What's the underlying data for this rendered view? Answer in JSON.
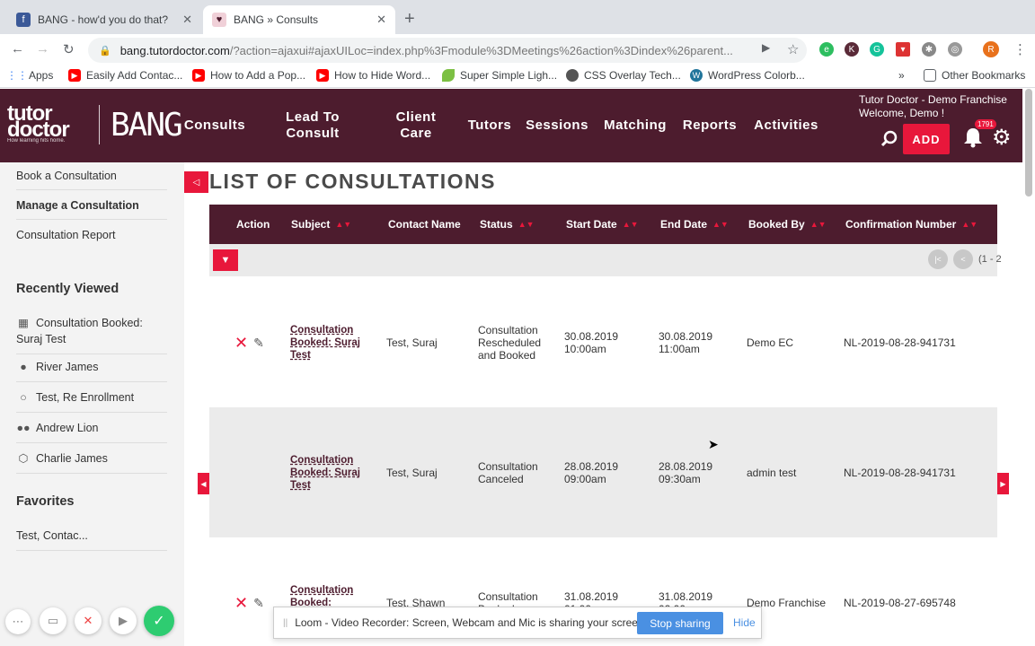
{
  "browser": {
    "tabs": [
      {
        "title": "BANG - how'd you do that?",
        "icon": "facebook-icon"
      },
      {
        "title": "BANG » Consults",
        "icon": "bang-favicon"
      }
    ],
    "url_host": "bang.tutordoctor.com",
    "url_rest": "/?action=ajaxui#ajaxUILoc=index.php%3Fmodule%3DMeetings%26action%3Dindex%26parent...",
    "bookmarks": [
      "Apps",
      "Easily Add Contac...",
      "How to Add a Pop...",
      "How to Hide Word...",
      "Super Simple Ligh...",
      "CSS Overlay Tech...",
      "WordPress Colorb..."
    ],
    "other_bookmarks": "Other Bookmarks",
    "profile_initial": "R"
  },
  "header": {
    "logo_text": "tutor doctor",
    "logo_sub": "How learning hits home.",
    "app_name": "BANG",
    "nav": [
      "Consults",
      "Lead To Consult",
      "Client Care",
      "Tutors",
      "Sessions",
      "Matching",
      "Reports",
      "Activities"
    ],
    "franchise": "Tutor Doctor - Demo Franchise",
    "welcome": "Welcome, Demo !",
    "add_label": "ADD",
    "notification_count": "1791"
  },
  "sidebar": {
    "links": [
      "Book a Consultation",
      "Manage a Consultation",
      "Consultation Report"
    ],
    "recently_viewed_title": "Recently Viewed",
    "recent": [
      {
        "label": "Consultation Booked: Suraj Test",
        "icon": "calendar-icon"
      },
      {
        "label": "River James",
        "icon": "person-icon"
      },
      {
        "label": "Test, Re Enrollment",
        "icon": "person-outline-icon"
      },
      {
        "label": "Andrew Lion",
        "icon": "people-icon"
      },
      {
        "label": "Charlie James",
        "icon": "cube-icon"
      }
    ],
    "favorites_title": "Favorites",
    "favorites": [
      "Test, Contac..."
    ]
  },
  "main": {
    "title": "LIST OF CONSULTATIONS",
    "columns": [
      "Action",
      "Subject",
      "Contact Name",
      "Status",
      "Start Date",
      "End Date",
      "Booked By",
      "Confirmation Number"
    ],
    "pagination": "(1 - 2",
    "rows": [
      {
        "subject": "Consultation Booked: Suraj Test",
        "contact": "Test, Suraj",
        "status": "Consultation Rescheduled and Booked",
        "start": "30.08.2019 10:00am",
        "end": "30.08.2019 11:00am",
        "booked_by": "Demo EC",
        "confirmation": "NL-2019-08-28-941731"
      },
      {
        "subject": "Consultation Booked: Suraj Test",
        "contact": "Test, Suraj",
        "status": "Consultation Canceled",
        "start": "28.08.2019 09:00am",
        "end": "28.08.2019 09:30am",
        "booked_by": "admin test",
        "confirmation": "NL-2019-08-28-941731"
      },
      {
        "subject": "Consultation Booked: Shawn Test",
        "contact": "Test, Shawn",
        "status": "Consultation Booked",
        "start": "31.08.2019 01:00am",
        "end": "31.08.2019 02:00am",
        "booked_by": "Demo Franchise",
        "confirmation": "NL-2019-08-27-695748"
      }
    ]
  },
  "loom": {
    "message": "Loom - Video Recorder: Screen, Webcam and Mic is sharing your screen.",
    "stop_label": "Stop sharing",
    "hide_label": "Hide"
  },
  "colors": {
    "brand": "#4d1c2e",
    "accent": "#e8173b"
  }
}
